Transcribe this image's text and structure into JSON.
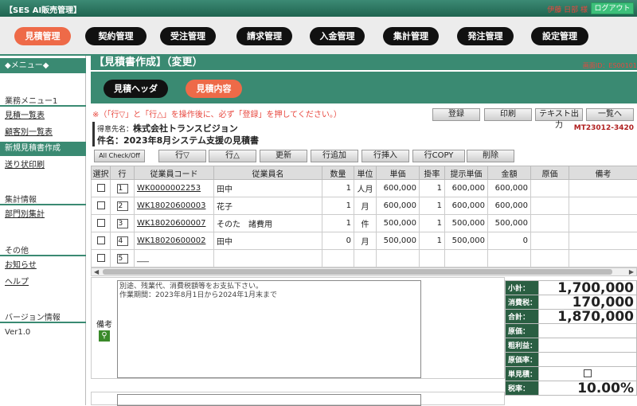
{
  "app": {
    "title": "【SES AI販売管理】",
    "user": "伊藤 日部 様",
    "logout": "ログアウト"
  },
  "nav": [
    "見積管理",
    "契約管理",
    "受注管理",
    "請求管理",
    "入金管理",
    "集計管理",
    "発注管理",
    "設定管理"
  ],
  "sidebar": {
    "header": "◆メニュー◆",
    "sections": [
      {
        "title": "業務メニュー1",
        "items": [
          "見積一覧表",
          "顧客別一覧表",
          "新規見積書作成",
          "送り状印刷"
        ]
      },
      {
        "title": "集計情報",
        "items": [
          "部門別集計"
        ]
      },
      {
        "title": "その他",
        "items": [
          "お知らせ",
          "ヘルプ"
        ]
      },
      {
        "title": "バージョン情報",
        "items": [
          "Ver1.0"
        ]
      }
    ]
  },
  "page": {
    "title": "【見積書作成】（変更）",
    "screen_id": "画面ID：ES00101"
  },
  "tabs": [
    "見積ヘッダ",
    "見積内容"
  ],
  "warning": "※（「行▽」と「行△」を操作後に、必ず「登録」を押してください。）",
  "actions": [
    "登録",
    "印刷",
    "テキスト出力",
    "一覧へ"
  ],
  "customer": {
    "label": "得意先名：",
    "value": "株式会社トランスビジョン"
  },
  "subject": {
    "label": "件名：",
    "value": "2023年8月システム支援の見積書"
  },
  "estimate_no": "MT23012-3420",
  "toolbar": [
    "All Check/Off",
    "行▽",
    "行△",
    "更新",
    "行追加",
    "行挿入",
    "行COPY",
    "削除"
  ],
  "grid": {
    "headers": [
      "選択",
      "行",
      "従業員コード",
      "従業員名",
      "数量",
      "単位",
      "単価",
      "掛率",
      "提示単価",
      "金額",
      "原価",
      "備考"
    ],
    "rows": [
      {
        "no": "1",
        "code": "WK0000002253",
        "name": "田中",
        "qty": "1",
        "unit": "人月",
        "price": "600,000",
        "rate": "1",
        "offer": "600,000",
        "amount": "600,000"
      },
      {
        "no": "2",
        "code": "WK18020600003",
        "name": "花子",
        "qty": "1",
        "unit": "月",
        "price": "600,000",
        "rate": "1",
        "offer": "600,000",
        "amount": "600,000"
      },
      {
        "no": "3",
        "code": "WK18020600007",
        "name": "そのた　諸費用",
        "qty": "1",
        "unit": "件",
        "price": "500,000",
        "rate": "1",
        "offer": "500,000",
        "amount": "500,000"
      },
      {
        "no": "4",
        "code": "WK18020600002",
        "name": "田中",
        "qty": "0",
        "unit": "月",
        "price": "500,000",
        "rate": "1",
        "offer": "500,000",
        "amount": "0"
      },
      {
        "no": "5",
        "code": "___",
        "name": "",
        "qty": "",
        "unit": "",
        "price": "",
        "rate": "",
        "offer": "",
        "amount": ""
      }
    ]
  },
  "notes": {
    "label": "備考",
    "text": "別途、残業代、消費税額等をお支払下さい。\n作業期間：2023年8月1日から2024年1月末まで"
  },
  "totals": [
    {
      "label": "小計：",
      "value": "1,700,000"
    },
    {
      "label": "消費税：",
      "value": "170,000"
    },
    {
      "label": "合計：",
      "value": "1,870,000"
    },
    {
      "label": "原価：",
      "value": ""
    },
    {
      "label": "粗利益：",
      "value": ""
    },
    {
      "label": "原価率：",
      "value": ""
    },
    {
      "label": "単見積：",
      "value": ""
    },
    {
      "label": "税率：",
      "value": "10.00%"
    }
  ]
}
